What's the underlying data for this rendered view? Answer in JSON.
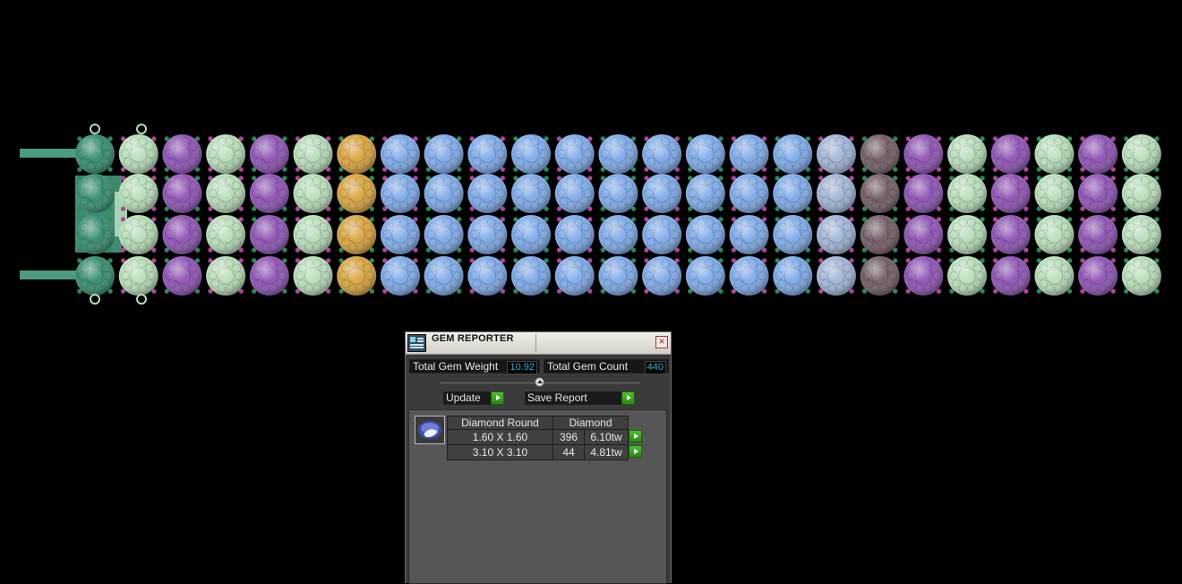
{
  "viewport": {
    "name": "3D bracelet model viewport",
    "gem_columns": [
      "#2f8a6a",
      "#b6dcb8",
      "#8c4fb3",
      "#b6dcb8",
      "#8c4fb3",
      "#b6dcb8",
      "#d8a23a",
      "#7ba8e8",
      "#7ba8e8",
      "#7ba8e8",
      "#7ba8e8",
      "#7ba8e8",
      "#7ba8e8",
      "#7ba8e8",
      "#7ba8e8",
      "#7ba8e8",
      "#7ba8e8",
      "#9fb4d6",
      "#6f5864",
      "#8c4fb3",
      "#b6dcb8",
      "#8c4fb3",
      "#b6dcb8",
      "#8c4fb3",
      "#b6dcb8"
    ],
    "rows": 4,
    "accent_colors": {
      "clasp": "#4c9b82",
      "prong_magenta": "#b0479a",
      "prong_green": "#2e8a5c"
    }
  },
  "gem_reporter": {
    "title": "GEM REPORTER",
    "close_label": "×",
    "total_gem_weight_label": "Total Gem Weight",
    "total_gem_weight_value": "10.92",
    "total_gem_count_label": "Total Gem Count",
    "total_gem_count_value": "440",
    "update_label": "Update",
    "save_report_label": "Save Report",
    "table": {
      "shape": "Diamond Round",
      "material": "Diamond",
      "rows": [
        {
          "size": "1.60 X 1.60",
          "count": "396",
          "weight": "6.10tw"
        },
        {
          "size": "3.10 X 3.10",
          "count": "44",
          "weight": "4.81tw"
        }
      ]
    },
    "value_color": "#2fb5d6",
    "button_color": "#3aa41f"
  }
}
